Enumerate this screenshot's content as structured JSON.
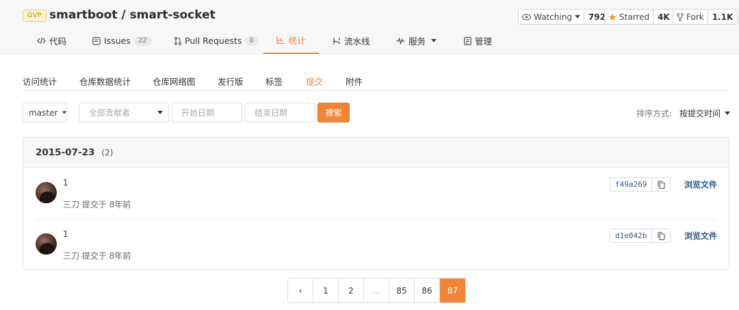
{
  "header": {
    "badge": "GVP",
    "repo_title": "smartboot / smart-socket",
    "watch": {
      "label": "Watching",
      "count": "792"
    },
    "star": {
      "label": "Starred",
      "count": "4K"
    },
    "fork": {
      "label": "Fork",
      "count": "1.1K"
    }
  },
  "nav_tabs": [
    {
      "label": "代码",
      "icon": "code-icon"
    },
    {
      "label": "Issues",
      "icon": "issues-icon",
      "badge": "22"
    },
    {
      "label": "Pull Requests",
      "icon": "pull-request-icon",
      "badge": "0"
    },
    {
      "label": "统计",
      "icon": "stats-icon",
      "active": true
    },
    {
      "label": "流水线",
      "icon": "pipeline-icon"
    },
    {
      "label": "服务",
      "icon": "pulse-icon"
    },
    {
      "label": "管理",
      "icon": "manage-icon"
    }
  ],
  "sub_tabs": [
    {
      "label": "访问统计"
    },
    {
      "label": "仓库数据统计"
    },
    {
      "label": "仓库网络图"
    },
    {
      "label": "发行版"
    },
    {
      "label": "标签"
    },
    {
      "label": "提交",
      "active": true
    },
    {
      "label": "附件"
    }
  ],
  "filters": {
    "branch": "master",
    "contributor_placeholder": "全部贡献者",
    "start_date_placeholder": "开始日期",
    "end_date_placeholder": "结束日期",
    "search_label": "搜索",
    "sort_label": "排序方式:",
    "sort_value": "按提交时间"
  },
  "commit_group": {
    "date": "2015-07-23",
    "count": "(2)",
    "commits": [
      {
        "message": "1",
        "meta": "三刀 提交于 8年前",
        "sha": "f49a269",
        "browse_label": "浏览文件"
      },
      {
        "message": "1",
        "meta": "三刀 提交于 8年前",
        "sha": "d1e042b",
        "browse_label": "浏览文件"
      }
    ]
  },
  "pagination": {
    "prev": "‹",
    "pages": [
      "1",
      "2",
      "...",
      "85",
      "86",
      "87"
    ],
    "current": "87"
  },
  "colors": {
    "accent": "#f08437",
    "link": "#2f5c85"
  }
}
